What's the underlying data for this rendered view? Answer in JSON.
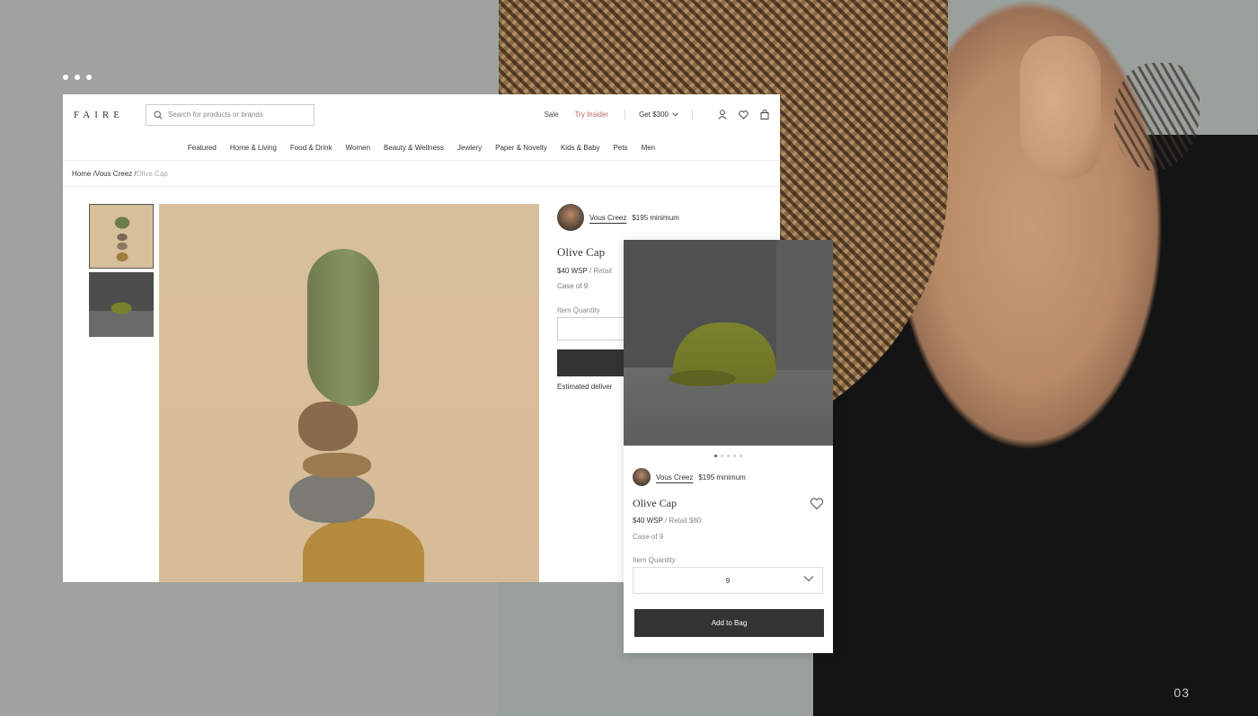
{
  "header": {
    "logo": "FAIRE",
    "search_placeholder": "Search for products or brands",
    "sale": "Sale",
    "try_insider": "Try Insider",
    "get_300": "Get $300"
  },
  "nav": [
    "Featured",
    "Home & Living",
    "Food & Drink",
    "Women",
    "Beauty & Wellness",
    "Jewlery",
    "Paper & Novelty",
    "Kids & Baby",
    "Pets",
    "Men"
  ],
  "breadcrumb": {
    "path": "Home /Vous Creez / ",
    "current": "Olive Cap"
  },
  "product": {
    "seller": "Vous Creez",
    "minimum": "$195 minimum",
    "title": "Olive Cap",
    "wsp": "$40 WSP",
    "retail_desktop": " / Retail",
    "retail_mobile": " / Retail $80",
    "case": "Case of 9",
    "qty_label": "Item Quantity",
    "delivery": "Estimated deliver"
  },
  "mobile": {
    "quantity_value": "9",
    "add_to_bag": "Add to Bag"
  },
  "page_number": "03",
  "colors": {
    "background": "#9ea39f",
    "insider_accent": "#b1625b",
    "button_dark": "#333333"
  }
}
